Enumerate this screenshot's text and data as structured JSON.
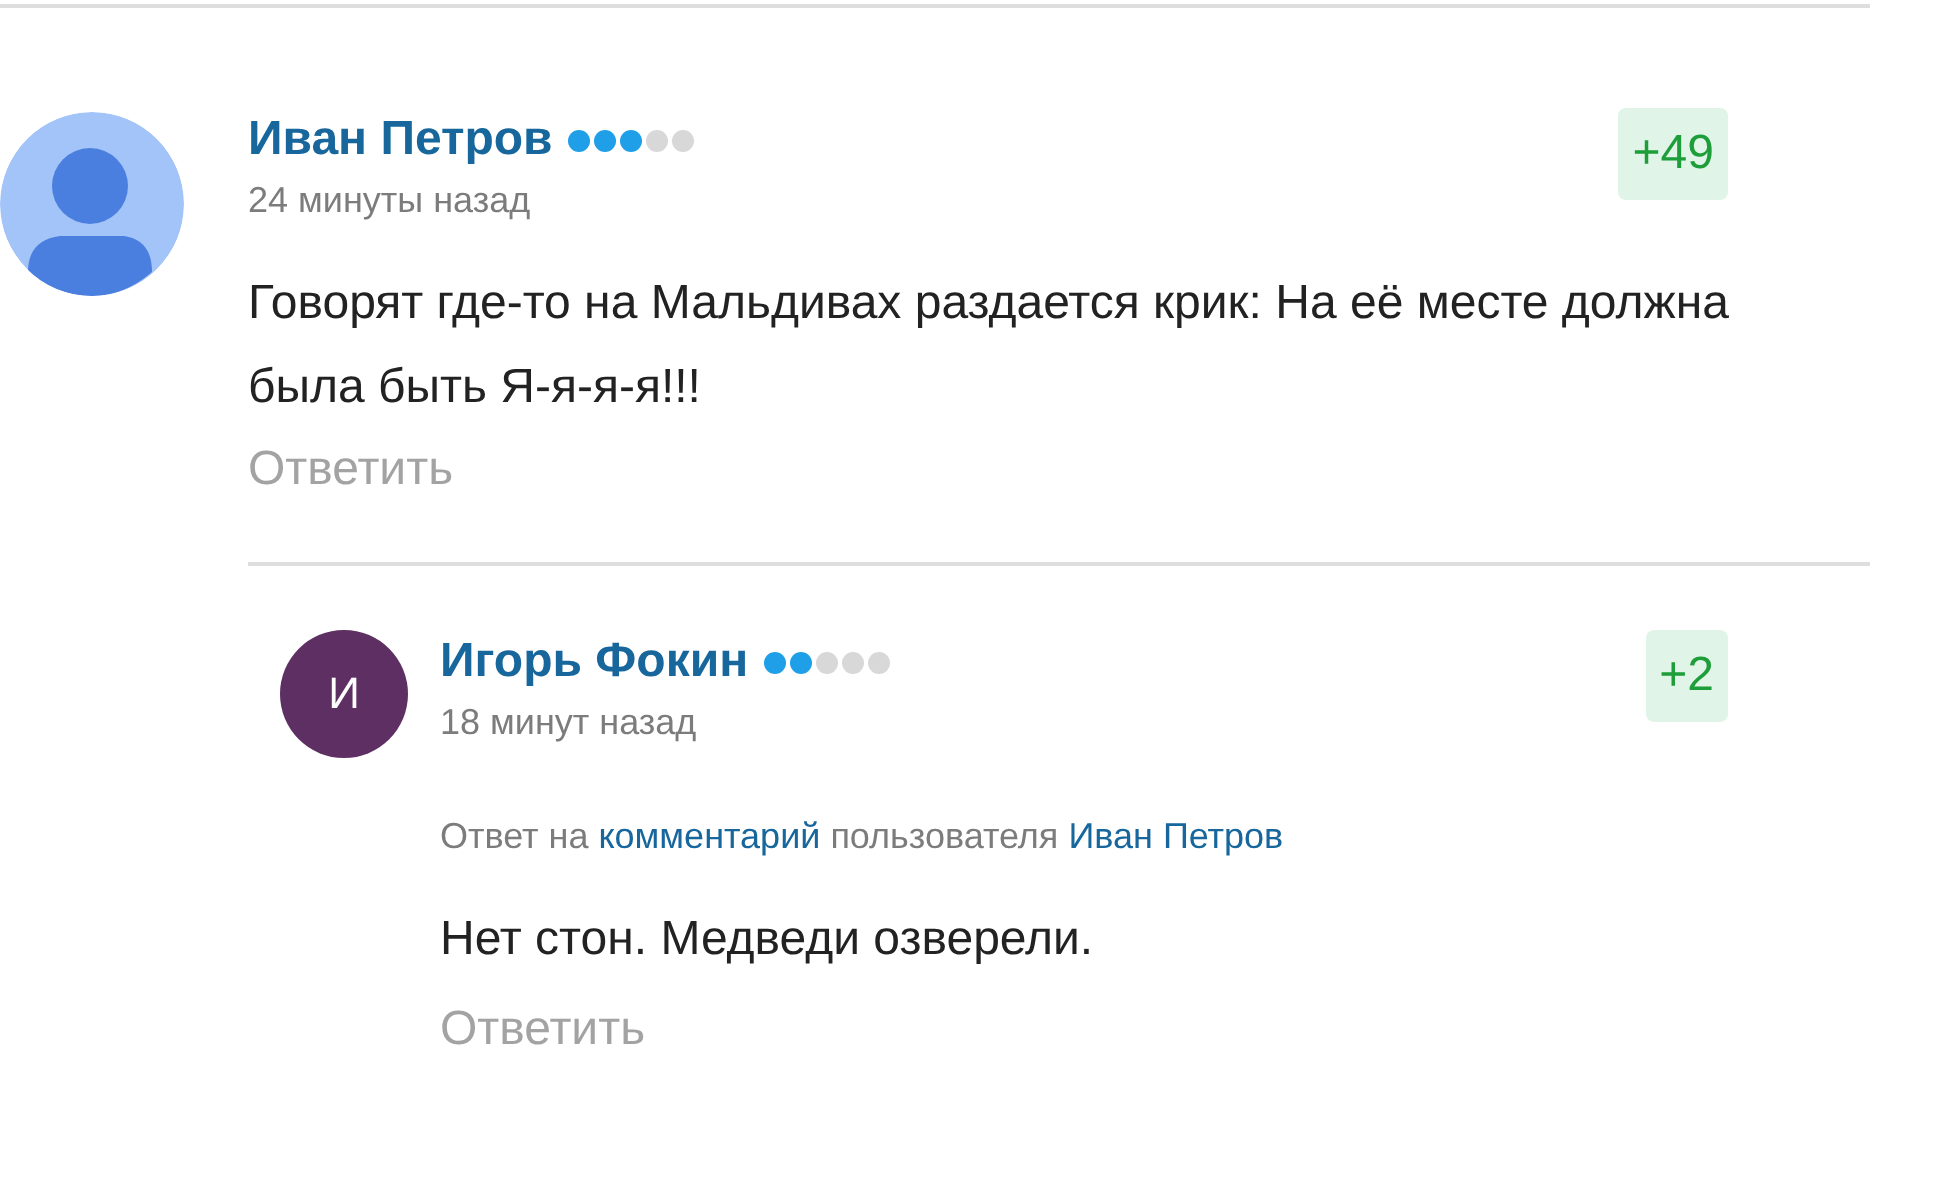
{
  "comments": [
    {
      "author": "Иван Петров",
      "stars": 3,
      "time": "24 минуты назад",
      "score": "+49",
      "avatar": {
        "kind": "silhouette"
      },
      "text": "Говорят где-то на Мальдивах раздается крик: На её месте должна была быть Я-я-я-я!!!",
      "reply_button": "Ответить",
      "replies": [
        {
          "author": "Игорь Фокин",
          "stars": 2,
          "time": "18 минут назад",
          "score": "+2",
          "avatar": {
            "kind": "letter",
            "letter": "И",
            "color": "#5e2f62"
          },
          "reply_to": {
            "prefix": "Ответ на",
            "link": "комментарий",
            "middle": "пользователя",
            "user": "Иван Петров"
          },
          "text": "Нет стон. Медведи озверели.",
          "reply_button": "Ответить"
        }
      ]
    }
  ]
}
